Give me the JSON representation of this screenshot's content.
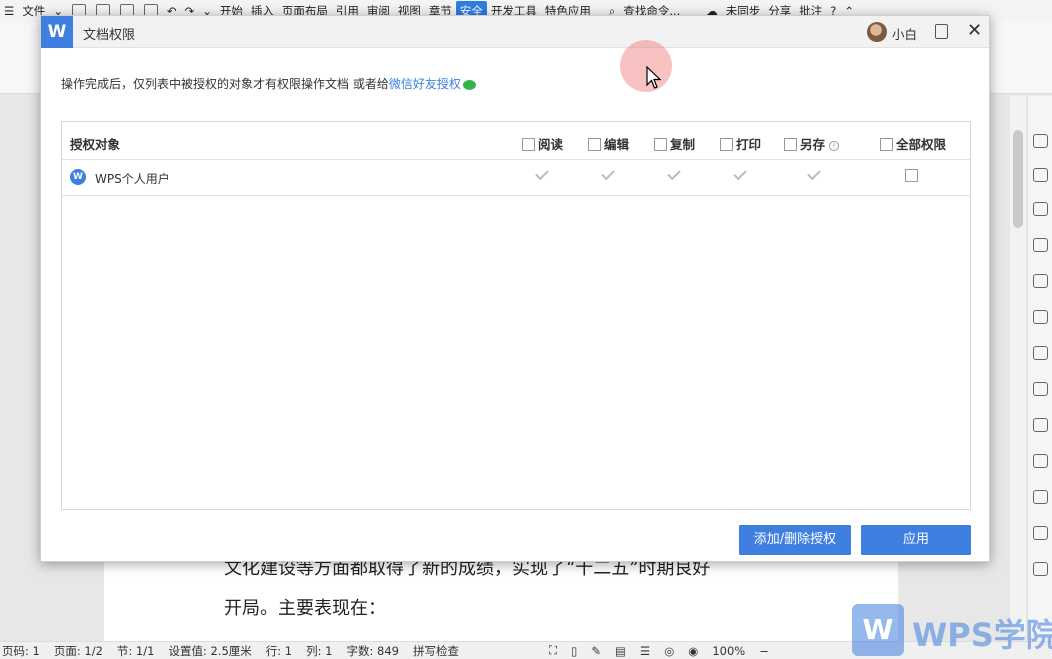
{
  "menubar": {
    "file_label": "文件",
    "tabs": [
      "开始",
      "插入",
      "页面布局",
      "引用",
      "审阅",
      "视图",
      "章节",
      "安全",
      "开发工具",
      "特色应用"
    ],
    "active_tab": "安全",
    "search_label": "查找命令...",
    "sync_label": "未同步",
    "share_label": "分享",
    "comment_label": "批注"
  },
  "document": {
    "line1": "文化建设等方面都取得了新的成绩，实现了“十二五”时期良好",
    "line2": "开局。主要表现在："
  },
  "dialog": {
    "title": "文档权限",
    "user_name": "小白",
    "notice_text": "操作完成后，仅列表中被授权的对象才有权限操作文档 或者给",
    "wechat_link": "微信好友授权",
    "table": {
      "columns": [
        "授权对象",
        "阅读",
        "编辑",
        "复制",
        "打印",
        "另存",
        "全部权限"
      ],
      "rows": [
        {
          "name": "WPS个人用户",
          "read": true,
          "edit": true,
          "copy": true,
          "print": true,
          "saveas": true,
          "all": false
        }
      ]
    },
    "buttons": {
      "add_remove": "添加/删除授权",
      "apply": "应用"
    }
  },
  "statusbar": {
    "page_num": "页码: 1",
    "pages": "页面: 1/2",
    "section": "节: 1/1",
    "setting": "设置值: 2.5厘米",
    "row": "行: 1",
    "col": "列: 1",
    "word_count": "字数: 849",
    "spellcheck": "拼写检查",
    "zoom": "100%"
  },
  "watermark": {
    "text": "WPS学院"
  },
  "colors": {
    "accent": "#3f7fe0",
    "wechat": "#36b24a"
  }
}
